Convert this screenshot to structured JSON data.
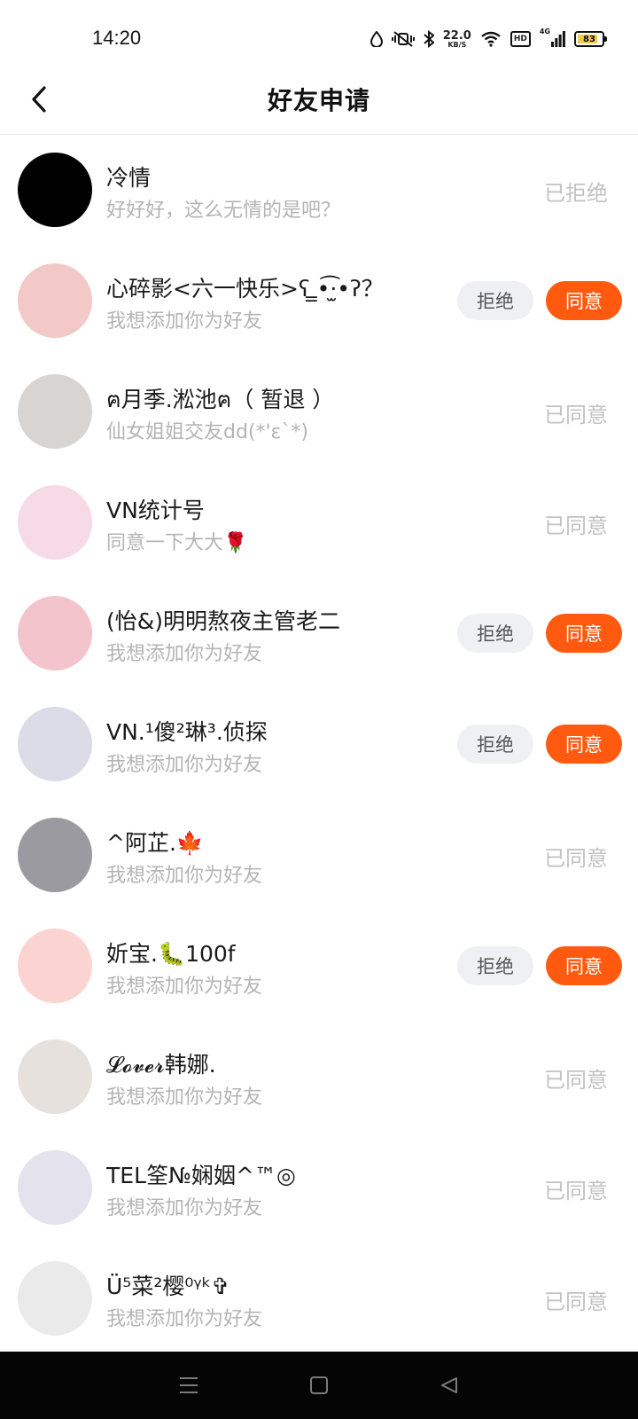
{
  "status_bar": {
    "time": "14:20",
    "net_speed": "22.0",
    "net_unit": "KB/S",
    "hd": "HD",
    "signal": "4G",
    "battery": "83"
  },
  "header": {
    "title": "好友申请"
  },
  "buttons": {
    "reject": "拒绝",
    "accept": "同意"
  },
  "requests": [
    {
      "name": "冷情",
      "message": "好好好，这么无情的是吧？",
      "status": "已拒绝",
      "pending": false,
      "avatar_color": "#000000"
    },
    {
      "name": "心碎影<六一快乐>ʕ ̳•͡·̫•ʔ？",
      "message": "我想添加你为好友",
      "status": "",
      "pending": true,
      "avatar_color": "#f3c9c8"
    },
    {
      "name": "ฅ月季.淞池ฅ（ 暂退 ）",
      "message": "仙女姐姐交友dd(*'ε`*)",
      "status": "已同意",
      "pending": false,
      "avatar_color": "#d7d4d2"
    },
    {
      "name": "VN统计号",
      "message": "同意一下大大🌹",
      "status": "已同意",
      "pending": false,
      "avatar_color": "#f6dbe6"
    },
    {
      "name": "(怡&)明明熬夜主管老二",
      "message": "我想添加你为好友",
      "status": "",
      "pending": true,
      "avatar_color": "#f4c4cc"
    },
    {
      "name": "VN.¹傻²琳³.侦探",
      "message": "我想添加你为好友",
      "status": "",
      "pending": true,
      "avatar_color": "#dcdbe8"
    },
    {
      "name": "^阿芷.🍁",
      "message": "我想添加你为好友",
      "status": "已同意",
      "pending": false,
      "avatar_color": "#9a9aa0"
    },
    {
      "name": "妡宝.🐛100f",
      "message": "我想添加你为好友",
      "status": "",
      "pending": true,
      "avatar_color": "#fbd3d0"
    },
    {
      "name": "𝓛𝓸𝓿𝓮𝓻韩娜.",
      "message": "我想添加你为好友",
      "status": "已同意",
      "pending": false,
      "avatar_color": "#e6e1dc"
    },
    {
      "name": "TEL筌№娴姻^™◎",
      "message": "我想添加你为好友",
      "status": "已同意",
      "pending": false,
      "avatar_color": "#e4e2ec"
    },
    {
      "name": "Ü⁵菜²樱⁰ᵞᵏ✞",
      "message": "我想添加你为好友",
      "status": "已同意",
      "pending": false,
      "avatar_color": "#eaeaea"
    }
  ]
}
